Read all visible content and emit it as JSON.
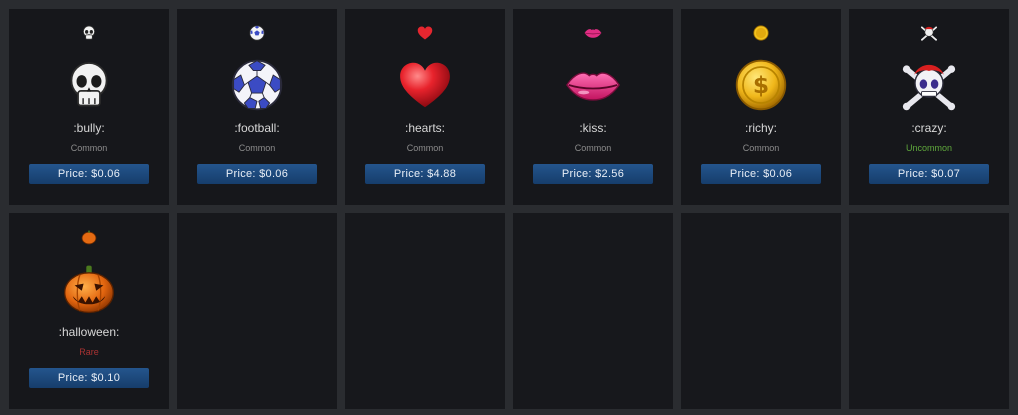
{
  "items": [
    {
      "name": ":bully:",
      "rarity": "Common",
      "rarity_color": "#8c8c8c",
      "price": "Price: $0.06",
      "icon": "skull-icon"
    },
    {
      "name": ":football:",
      "rarity": "Common",
      "rarity_color": "#8c8c8c",
      "price": "Price: $0.06",
      "icon": "soccer-ball-icon"
    },
    {
      "name": ":hearts:",
      "rarity": "Common",
      "rarity_color": "#8c8c8c",
      "price": "Price: $4.88",
      "icon": "heart-icon"
    },
    {
      "name": ":kiss:",
      "rarity": "Common",
      "rarity_color": "#8c8c8c",
      "price": "Price: $2.56",
      "icon": "lips-icon"
    },
    {
      "name": ":richy:",
      "rarity": "Common",
      "rarity_color": "#8c8c8c",
      "price": "Price: $0.06",
      "icon": "gold-coin-icon"
    },
    {
      "name": ":crazy:",
      "rarity": "Uncommon",
      "rarity_color": "#5fa83c",
      "price": "Price: $0.07",
      "icon": "crazy-skull-icon"
    },
    {
      "name": ":halloween:",
      "rarity": "Rare",
      "rarity_color": "#a83232",
      "price": "Price: $0.10",
      "icon": "pumpkin-icon"
    }
  ],
  "colors": {
    "card_bg": "#16171b",
    "page_bg": "#2a2c30",
    "button_bg": "#1d4a7c"
  }
}
